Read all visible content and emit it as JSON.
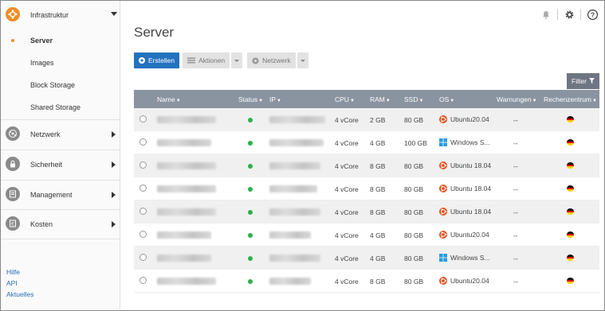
{
  "sidebar": {
    "sections": [
      {
        "label": "Infrastruktur",
        "icon": "infrastructure-icon",
        "expanded": true
      },
      {
        "label": "Netzwerk",
        "icon": "network-icon"
      },
      {
        "label": "Sicherheit",
        "icon": "lock-icon"
      },
      {
        "label": "Management",
        "icon": "management-icon"
      },
      {
        "label": "Kosten",
        "icon": "costs-icon"
      }
    ],
    "sub_items": [
      "Server",
      "Images",
      "Block Storage",
      "Shared Storage"
    ],
    "active_sub_item": "Server",
    "footer_links": [
      "Hilfe",
      "API",
      "Aktuelles"
    ]
  },
  "header": {
    "icons": [
      "bell-icon",
      "gear-icon",
      "help-icon"
    ]
  },
  "main": {
    "title": "Server",
    "toolbar": {
      "create_label": "Erstellen",
      "actions_label": "Aktionen",
      "network_label": "Netzwerk"
    },
    "filter_label": "Filter",
    "table": {
      "columns": [
        "Name",
        "Status",
        "IP",
        "CPU",
        "RAM",
        "SSD",
        "OS",
        "Warnungen",
        "Rechenzentrum"
      ],
      "rows": [
        {
          "cpu": "4 vCore",
          "ram": "2 GB",
          "ssd": "80 GB",
          "os": "Ubuntu20.04",
          "os_type": "ubuntu",
          "warnings": "--"
        },
        {
          "cpu": "4 vCore",
          "ram": "4 GB",
          "ssd": "100 GB",
          "os": "Windows S...",
          "os_type": "windows",
          "warnings": "--"
        },
        {
          "cpu": "4 vCore",
          "ram": "8 GB",
          "ssd": "80 GB",
          "os": "Ubuntu 18.04",
          "os_type": "ubuntu",
          "warnings": "--"
        },
        {
          "cpu": "4 vCore",
          "ram": "8 GB",
          "ssd": "80 GB",
          "os": "Ubuntu 18.04",
          "os_type": "ubuntu",
          "warnings": "--"
        },
        {
          "cpu": "4 vCore",
          "ram": "8 GB",
          "ssd": "80 GB",
          "os": "Ubuntu 18.04",
          "os_type": "ubuntu",
          "warnings": "--"
        },
        {
          "cpu": "4 vCore",
          "ram": "4 GB",
          "ssd": "80 GB",
          "os": "Ubuntu20.04",
          "os_type": "ubuntu",
          "warnings": "--"
        },
        {
          "cpu": "4 vCore",
          "ram": "4 GB",
          "ssd": "80 GB",
          "os": "Windows S...",
          "os_type": "windows",
          "warnings": "--"
        },
        {
          "cpu": "4 vCore",
          "ram": "8 GB",
          "ssd": "80 GB",
          "os": "Ubuntu20.04",
          "os_type": "ubuntu",
          "warnings": "--"
        }
      ]
    }
  },
  "colors": {
    "accent": "#f08c28",
    "primary": "#2372c0",
    "header": "#8a93a0",
    "status_ok": "#2bb24c",
    "link": "#2a6fb8"
  }
}
